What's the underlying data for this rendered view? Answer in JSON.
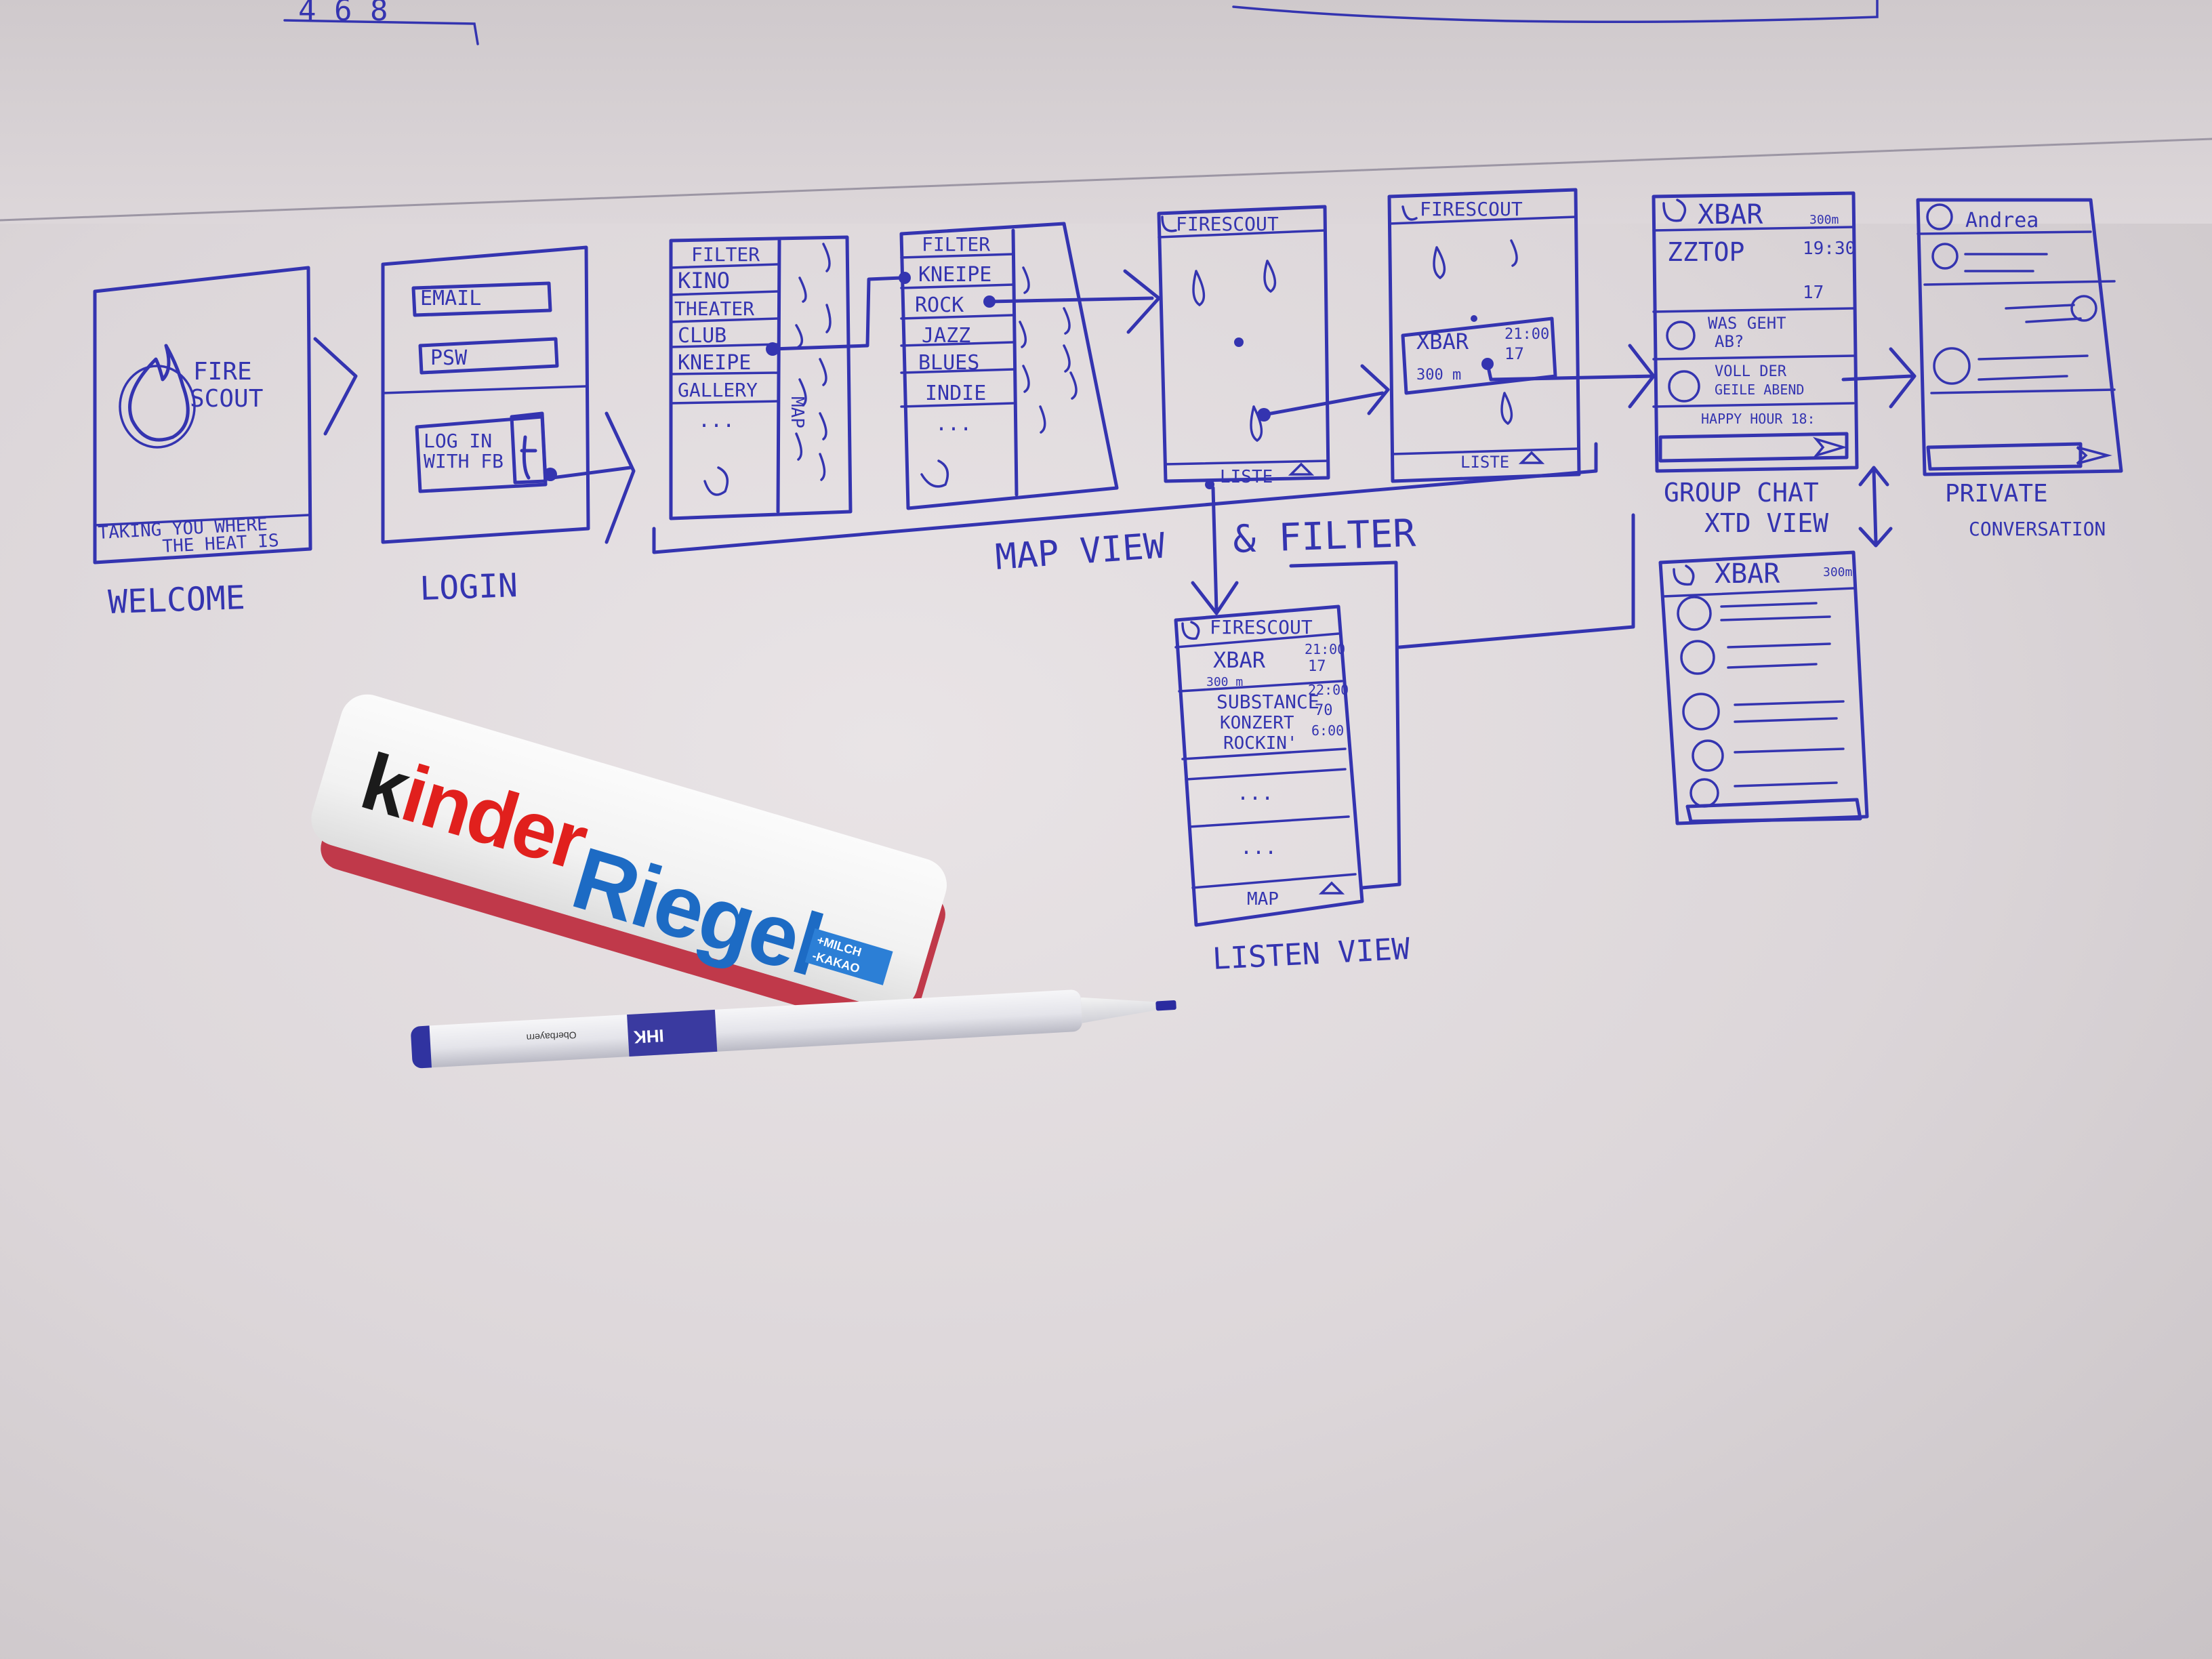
{
  "top_scraps": {
    "numbers": "4 6 8"
  },
  "screens": {
    "welcome": {
      "logo_line1": "FIRE",
      "logo_line2": "SCOUT",
      "tagline_line1": "TAKING YOU WHERE",
      "tagline_line2": "THE HEAT IS",
      "caption": "WELCOME"
    },
    "login": {
      "email": "EMAIL",
      "password": "PSW",
      "fb_line1": "LOG IN",
      "fb_line2": "WITH FB",
      "caption": "LOGIN"
    },
    "filter1": {
      "header": "FILTER",
      "items": [
        "KINO",
        "THEATER",
        "CLUB",
        "KNEIPE",
        "GALLERY",
        "..."
      ],
      "side": "MAP"
    },
    "filter2": {
      "header": "FILTER",
      "items": [
        "KNEIPE",
        "ROCK",
        "JAZZ",
        "BLUES",
        "INDIE",
        "..."
      ]
    },
    "map1": {
      "header": "FIRESCOUT",
      "footer": "LISTE"
    },
    "map2": {
      "header": "FIRESCOUT",
      "popup_name": "XBAR",
      "popup_time": "21:00",
      "popup_count": "17",
      "popup_dist": "300 m",
      "footer": "LISTE"
    },
    "map_caption": "MAP VIEW",
    "filter_caption": "& FILTER",
    "group_chat": {
      "header": "XBAR",
      "header_dist": "300m",
      "event": "ZZTOP",
      "event_time": "19:30",
      "event_count": "17",
      "msg1_line1": "WAS GEHT",
      "msg1_line2": "AB?",
      "msg2_line1": "VOLL DER",
      "msg2_line2": "GEILE ABEND",
      "msg3": "HAPPY HOUR 18:",
      "caption_line1": "GROUP CHAT",
      "caption_line2": "XTD VIEW"
    },
    "private": {
      "header": "Andrea",
      "caption_line1": "PRIVATE",
      "caption_line2": "CONVERSATION"
    },
    "xtd": {
      "header": "XBAR",
      "header_dist": "300m"
    },
    "list": {
      "header": "FIRESCOUT",
      "row1_name": "XBAR",
      "row1_time": "21:00",
      "row1_count": "17",
      "row1_dist": "300 m",
      "row2_name": "SUBSTANCE",
      "row2_name2": "KONZERT",
      "row2_name3": "ROCKIN'",
      "row2_time": "22:00",
      "row2_count": "70",
      "row2_extra": "6:00",
      "dots": "...",
      "footer": "MAP",
      "caption": "LISTEN VIEW"
    }
  },
  "candy": {
    "brand_k": "k",
    "brand_inder": "inder",
    "brand_riegel": "Riegel",
    "badge_line1": "+MILCH",
    "badge_line2": "-KAKAO"
  },
  "pen": {
    "brand": "IHK",
    "print": "Oberbayern"
  },
  "colors": {
    "ink": "#3434b0",
    "paper": "#e8e3e5",
    "kinder_red": "#e1201d",
    "riegel_blue": "#1d6bc4"
  }
}
